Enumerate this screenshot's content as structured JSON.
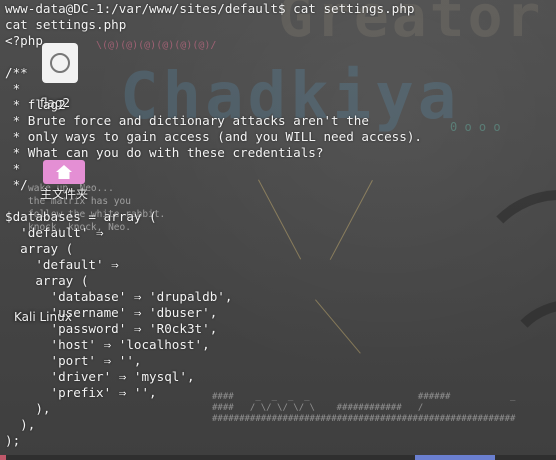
{
  "desktop": {
    "icons": [
      {
        "label": "Trash",
        "icon": "trash-icon"
      },
      {
        "label": "flag2",
        "icon": "folder-icon"
      },
      {
        "label": "主文件夹",
        "icon": "home-icon"
      },
      {
        "label": "Kali Linux",
        "icon": "kali-icon"
      }
    ],
    "wallpaper": {
      "logo_top": "Greator",
      "logo_mid": "Chadkiya",
      "pink_art": "\\(@)(@)(@)(@)(@)(@)/",
      "green_art": "0 o o o",
      "matrix_text": "wake up, Neo...\nthe matrix has you\nfollow the white rabbit.\nknock, knock, Neo.",
      "field_text": "####    _  _  _  _                    ######           _\n####   / \\/ \\/ \\/ \\    ############   /\n########################################################"
    }
  },
  "terminal": {
    "lines": [
      "www-data@DC-1:/var/www/sites/default$ cat settings.php",
      "cat settings.php",
      "<?php",
      "",
      "/**",
      " *",
      " * flag2",
      " * Brute force and dictionary attacks aren't the",
      " * only ways to gain access (and you WILL need access).",
      " * What can you do with these credentials?",
      " *",
      " */",
      "",
      "$databases = array (",
      "  'default' ⇒",
      "  array (",
      "    'default' ⇒",
      "    array (",
      "      'database' ⇒ 'drupaldb',",
      "      'username' ⇒ 'dbuser',",
      "      'password' ⇒ 'R0ck3t',",
      "      'host' ⇒ 'localhost',",
      "      'port' ⇒ '',",
      "      'driver' ⇒ 'mysql',",
      "      'prefix' ⇒ '',",
      "    ),",
      "  ),",
      ");"
    ]
  },
  "colors": {
    "background": "#474747",
    "terminal_text": "#f4f4f4",
    "home_icon": "#e48fd4",
    "accent": "#c0586a"
  }
}
